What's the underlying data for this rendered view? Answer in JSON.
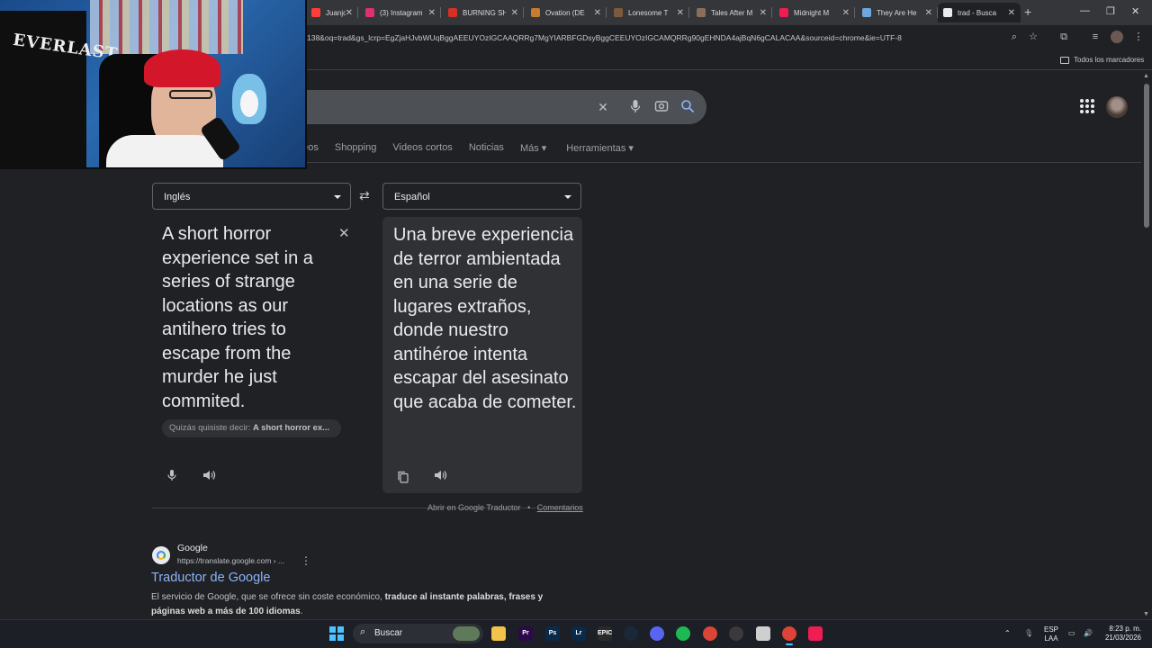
{
  "browser": {
    "tabs": [
      {
        "title": "Juanjo",
        "favicon_color": "#ff3d3d"
      },
      {
        "title": "(3) Instagram",
        "favicon_color": "#e1306c"
      },
      {
        "title": "BURNING SH",
        "favicon_color": "#d93025"
      },
      {
        "title": "Ovation (DE",
        "favicon_color": "#c77d2e"
      },
      {
        "title": "Lonesome T",
        "favicon_color": "#7d5a3c"
      },
      {
        "title": "Tales After M",
        "favicon_color": "#8a6e5a"
      },
      {
        "title": "Midnight M",
        "favicon_color": "#ee1d52"
      },
      {
        "title": "They Are He",
        "favicon_color": "#6fa8dc"
      },
      {
        "title": "trad - Busca",
        "favicon_color": "#e8eaed"
      }
    ],
    "url": "138&oq=trad&gs_lcrp=EgZjaHJvbWUqBggAEEUYOzIGCAAQRRg7MgYIARBFGDsyBggCEEUYOzIGCAMQRRg90gEHNDA4ajBqN6gCALACAA&sourceid=chrome&ie=UTF-8",
    "bookmarks_label": "Todos los marcadores"
  },
  "search": {
    "nav_tabs": [
      "deos",
      "Shopping",
      "Videos cortos",
      "Noticias",
      "Más ▾",
      "Herramientas ▾"
    ]
  },
  "translator": {
    "source_lang": "Inglés",
    "target_lang": "Español",
    "source_text": "A short horror experience set in a series of strange locations as our antihero tries to escape from the murder he just commited.",
    "suggestion_prefix": "Quizás quisiste decir:",
    "suggestion_value": "A short horror ex...",
    "target_text": "Una breve experiencia de terror ambientada en una serie de lugares extraños, donde nuestro antihéroe intenta escapar del asesinato que acaba de cometer.",
    "open_link": "Abrir en Google Traductor",
    "bullet": "•",
    "comments_link": "Comentarios"
  },
  "result": {
    "site_name": "Google",
    "site_url": "https://translate.google.com › ...",
    "title": "Traductor de Google",
    "snippet_plain": "El servicio de Google, que se ofrece sin coste económico,",
    "snippet_bold": "traduce al instante palabras, frases y páginas web a más de 100 idiomas",
    "snippet_end": "."
  },
  "webcam": {
    "bag_text": "EVERLAST"
  },
  "taskbar": {
    "search_label": "Buscar",
    "apps": [
      {
        "name": "file-explorer",
        "label": "",
        "color": "#f2c24a"
      },
      {
        "name": "premiere",
        "label": "Pr",
        "color": "#2a0a4a"
      },
      {
        "name": "photoshop",
        "label": "Ps",
        "color": "#0a2a4a"
      },
      {
        "name": "lightroom",
        "label": "Lr",
        "color": "#0a2a4a"
      },
      {
        "name": "epic-games",
        "label": "EPIC",
        "color": "#2a2a2a"
      },
      {
        "name": "steam",
        "label": "",
        "color": "#1b2838"
      },
      {
        "name": "discord",
        "label": "",
        "color": "#5865f2"
      },
      {
        "name": "spotify",
        "label": "",
        "color": "#1db954"
      },
      {
        "name": "chrome",
        "label": "",
        "color": "#db4437"
      },
      {
        "name": "obs",
        "label": "",
        "color": "#3a3a3a"
      },
      {
        "name": "app-cat",
        "label": "",
        "color": "#cfcfcf"
      },
      {
        "name": "chrome-active",
        "label": "",
        "color": "#db4437"
      },
      {
        "name": "tiktok",
        "label": "",
        "color": "#ee1d52"
      }
    ],
    "lang_top": "ESP",
    "lang_bottom": "LAA",
    "time": "8:23 p. m.",
    "date": "21/03/2026"
  }
}
